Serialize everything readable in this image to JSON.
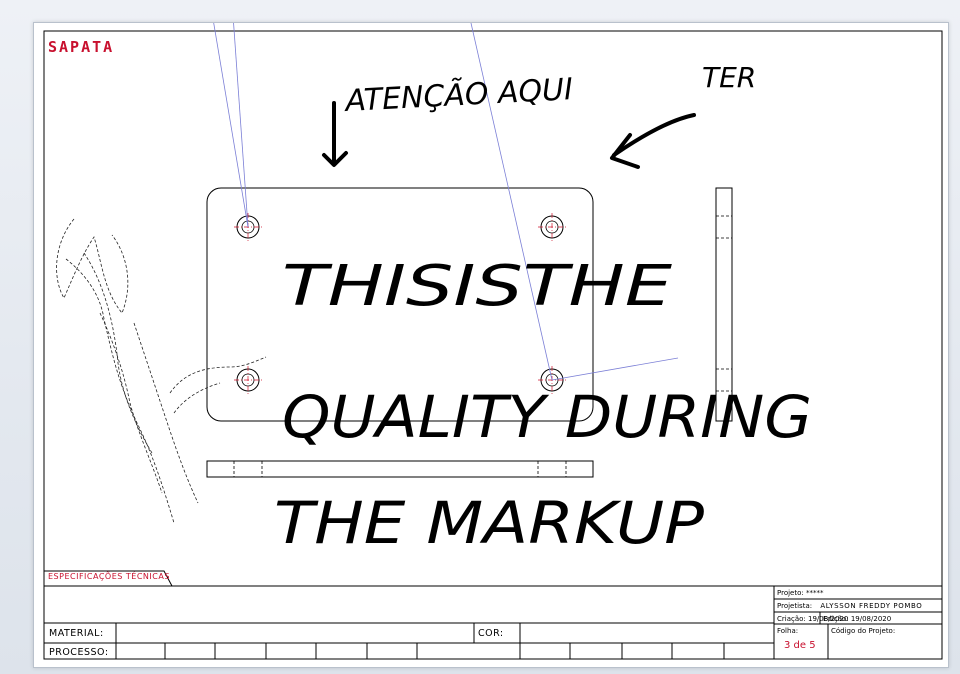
{
  "sheet": {
    "title": "SAPATA",
    "specs_tab": "ESPECIFICAÇÕES TÉCNICAS"
  },
  "markup": {
    "attention_note": "ATENÇÃO AQUI",
    "ter_note": "TER",
    "big_note_line1": "THISISTHE",
    "big_note_line2": "QUALITY DURING",
    "big_note_line3": "THE MARKUP"
  },
  "title_block": {
    "material_label": "MATERIAL:",
    "processo_label": "PROCESSO:",
    "cor_label": "COR:",
    "projeto_label": "Projeto:",
    "projeto_value": "*****",
    "projetista_label": "Projetista:",
    "projetista_value": "ALYSSON FREDDY POMBO",
    "criacao_label": "Criação:",
    "criacao_value": "19/08/2020",
    "edicao_label": "Edição:",
    "edicao_value": "19/08/2020",
    "folha_label": "Folha:",
    "folha_value": "3 de 5",
    "codigo_label": "Código do Projeto:"
  },
  "colors": {
    "title_red": "#c8102e",
    "markup_ink": "#000000",
    "center_red": "#d0142c",
    "leader_blue": "#7b7fd6"
  }
}
